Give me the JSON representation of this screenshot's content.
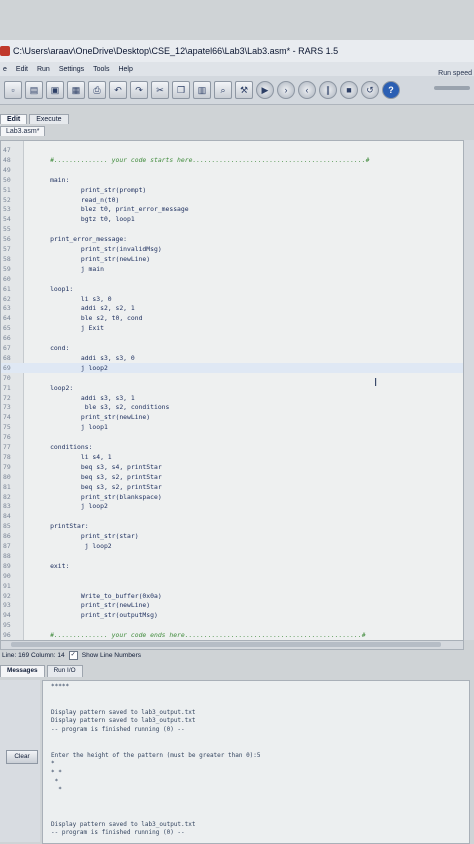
{
  "window": {
    "title": "C:\\Users\\araav\\OneDrive\\Desktop\\CSE_12\\apatel66\\Lab3\\Lab3.asm* - RARS 1.5"
  },
  "menu": [
    "e",
    "Edit",
    "Run",
    "Settings",
    "Tools",
    "Help"
  ],
  "toolbar": {
    "icons": [
      "new-file-icon",
      "open-icon",
      "save-icon",
      "save-all-icon",
      "print-icon",
      "undo-icon",
      "redo-icon",
      "cut-icon",
      "copy-icon",
      "paste-icon",
      "find-icon",
      "assemble-icon",
      "run-icon",
      "step-icon",
      "backstep-icon",
      "pause-icon",
      "stop-icon",
      "reset-icon",
      "help-icon"
    ],
    "run_speed_label": "Run speed"
  },
  "tabs": {
    "edit": "Edit",
    "execute": "Execute",
    "file": "Lab3.asm*"
  },
  "editor": {
    "lines": [
      {
        "n": "47",
        "code": "",
        "type": "code"
      },
      {
        "n": "48",
        "code": "      #.............. your code starts here.............................................#",
        "type": "comment"
      },
      {
        "n": "49",
        "code": "",
        "type": "code"
      },
      {
        "n": "50",
        "code": "      main:",
        "type": "label"
      },
      {
        "n": "51",
        "code": "              print_str(prompt)",
        "type": "code"
      },
      {
        "n": "52",
        "code": "              read_n(t0)",
        "type": "code"
      },
      {
        "n": "53",
        "code": "              blez t0, print_error_message",
        "type": "code"
      },
      {
        "n": "54",
        "code": "              bgtz t0, loop1",
        "type": "code"
      },
      {
        "n": "55",
        "code": "",
        "type": "code"
      },
      {
        "n": "56",
        "code": "      print_error_message:",
        "type": "label"
      },
      {
        "n": "57",
        "code": "              print_str(invalidMsg)",
        "type": "code"
      },
      {
        "n": "58",
        "code": "              print_str(newLine)",
        "type": "code"
      },
      {
        "n": "59",
        "code": "              j main",
        "type": "code"
      },
      {
        "n": "60",
        "code": "",
        "type": "code"
      },
      {
        "n": "61",
        "code": "      loop1:",
        "type": "label"
      },
      {
        "n": "62",
        "code": "              li s3, 0",
        "type": "code"
      },
      {
        "n": "63",
        "code": "              addi s2, s2, 1",
        "type": "code"
      },
      {
        "n": "64",
        "code": "              ble s2, t0, cond",
        "type": "code"
      },
      {
        "n": "65",
        "code": "              j Exit",
        "type": "code"
      },
      {
        "n": "66",
        "code": "",
        "type": "code"
      },
      {
        "n": "67",
        "code": "      cond:",
        "type": "label"
      },
      {
        "n": "68",
        "code": "              addi s3, s3, 0",
        "type": "code"
      },
      {
        "n": "69",
        "code": "              j loop2",
        "type": "code"
      },
      {
        "n": "70",
        "code": "",
        "type": "code"
      },
      {
        "n": "71",
        "code": "      loop2:",
        "type": "label"
      },
      {
        "n": "72",
        "code": "              addi s3, s3, 1",
        "type": "code"
      },
      {
        "n": "73",
        "code": "               ble s3, s2, conditions",
        "type": "code"
      },
      {
        "n": "74",
        "code": "              print_str(newLine)",
        "type": "code"
      },
      {
        "n": "75",
        "code": "              j loop1",
        "type": "code"
      },
      {
        "n": "76",
        "code": "",
        "type": "code"
      },
      {
        "n": "77",
        "code": "      conditions:",
        "type": "label"
      },
      {
        "n": "78",
        "code": "              li s4, 1",
        "type": "code"
      },
      {
        "n": "79",
        "code": "              beq s3, s4, printStar",
        "type": "code"
      },
      {
        "n": "80",
        "code": "              beq s3, s2, printStar",
        "type": "code"
      },
      {
        "n": "81",
        "code": "              beq s3, s2, printStar",
        "type": "code"
      },
      {
        "n": "82",
        "code": "              print_str(blankspace)",
        "type": "code"
      },
      {
        "n": "83",
        "code": "              j loop2",
        "type": "code"
      },
      {
        "n": "84",
        "code": "",
        "type": "code"
      },
      {
        "n": "85",
        "code": "      printStar:",
        "type": "label"
      },
      {
        "n": "86",
        "code": "              print_str(star)",
        "type": "code"
      },
      {
        "n": "87",
        "code": "               j loop2",
        "type": "code"
      },
      {
        "n": "88",
        "code": "",
        "type": "code"
      },
      {
        "n": "89",
        "code": "      exit:",
        "type": "label"
      },
      {
        "n": "90",
        "code": "",
        "type": "code"
      },
      {
        "n": "91",
        "code": "",
        "type": "code"
      },
      {
        "n": "92",
        "code": "              Write_to_buffer(0x0a)",
        "type": "code"
      },
      {
        "n": "93",
        "code": "              print_str(newLine)",
        "type": "code"
      },
      {
        "n": "94",
        "code": "              print_str(outputMsg)",
        "type": "code"
      },
      {
        "n": "95",
        "code": "",
        "type": "code"
      },
      {
        "n": "96",
        "code": "      #.............. your code ends here..............................................#",
        "type": "comment"
      }
    ],
    "highlighted_line": "69"
  },
  "status": {
    "position": "Line: 169 Column: 14",
    "show_line_numbers": "Show Line Numbers"
  },
  "bottom_tabs": {
    "messages": "Messages",
    "run_io": "Run I/O"
  },
  "console": {
    "lines": [
      "*****",
      "",
      "",
      "Display pattern saved to lab3_output.txt",
      "Display pattern saved to lab3_output.txt",
      "-- program is finished running (0) --",
      "",
      "",
      "Enter the height of the pattern (must be greater than 0):5",
      "*",
      "* *",
      " *",
      "  *",
      "",
      "",
      "",
      "Display pattern saved to lab3_output.txt",
      "-- program is finished running (0) --"
    ],
    "clear_label": "Clear"
  }
}
